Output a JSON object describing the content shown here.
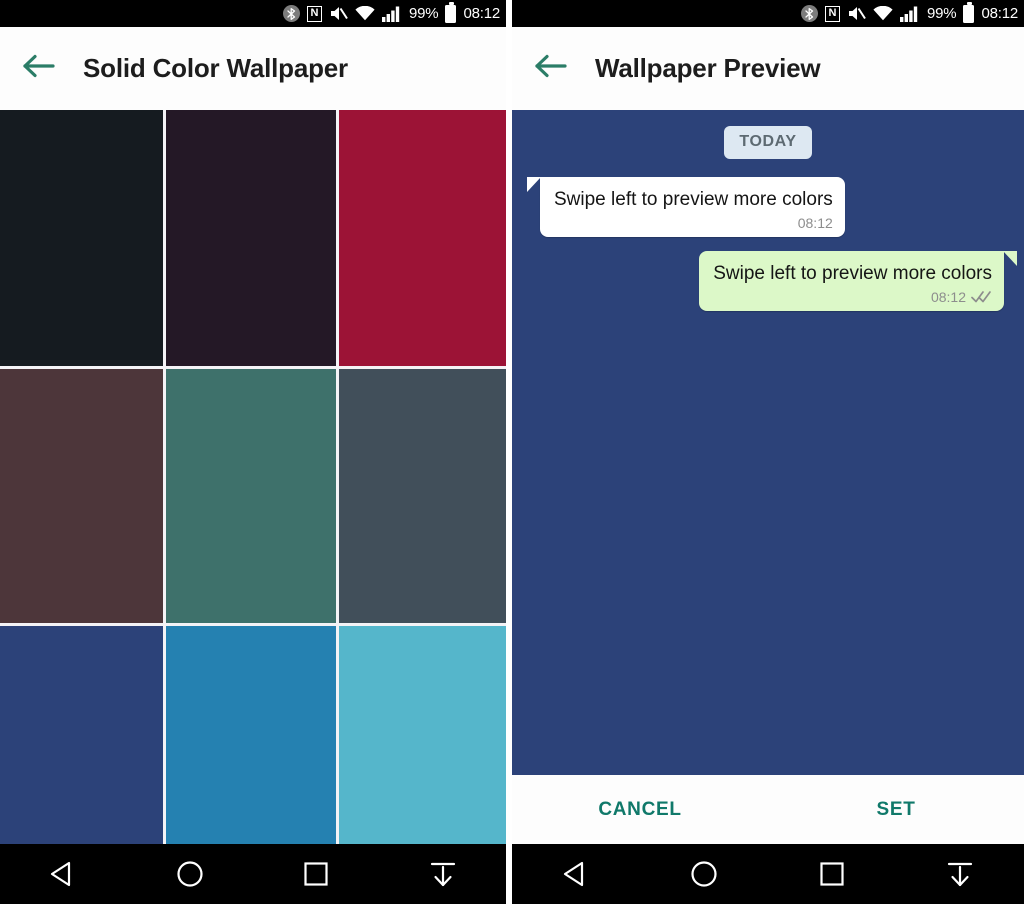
{
  "status_bar": {
    "bluetooth_icon": "bluetooth-icon",
    "bluetooth_glyph": "ᛦ",
    "nfc_icon": "nfc-icon",
    "nfc_glyph": "N",
    "mute_icon": "volume-mute-icon",
    "wifi_icon": "wifi-icon",
    "signal_icon": "cellular-signal-icon",
    "battery_percent": "99%",
    "battery_icon": "battery-full-icon",
    "clock": "08:12"
  },
  "left_screen": {
    "back_icon": "back-arrow-icon",
    "title": "Solid Color Wallpaper",
    "grid": {
      "rows": 3,
      "cols": 3,
      "swatches": [
        {
          "name": "near-black",
          "hex": "#151b20"
        },
        {
          "name": "dark-plum",
          "hex": "#241826"
        },
        {
          "name": "crimson",
          "hex": "#9c1336"
        },
        {
          "name": "dark-maroon",
          "hex": "#4d363a"
        },
        {
          "name": "teal",
          "hex": "#3e716b"
        },
        {
          "name": "slate-grey",
          "hex": "#414f5a"
        },
        {
          "name": "navy-blue",
          "hex": "#2c4279"
        },
        {
          "name": "medium-blue",
          "hex": "#2581b1"
        },
        {
          "name": "light-cyan-blue",
          "hex": "#55b6cb"
        }
      ]
    }
  },
  "right_screen": {
    "back_icon": "back-arrow-icon",
    "title": "Wallpaper Preview",
    "chat": {
      "background_hex": "#2c4279",
      "date_divider": "TODAY",
      "messages": [
        {
          "direction": "incoming",
          "text": "Swipe left to preview more colors",
          "time": "08:12",
          "status": ""
        },
        {
          "direction": "outgoing",
          "text": "Swipe left to preview more colors",
          "time": "08:12",
          "status": "read-double-check-icon"
        }
      ]
    },
    "actions": {
      "cancel_label": "CANCEL",
      "set_label": "SET",
      "accent_hex": "#10796a"
    }
  },
  "nav_bar": {
    "back_label": "back-triangle-icon",
    "home_label": "home-circle-icon",
    "recents_label": "recents-square-icon",
    "hide_label": "hide-navbar-icon"
  }
}
